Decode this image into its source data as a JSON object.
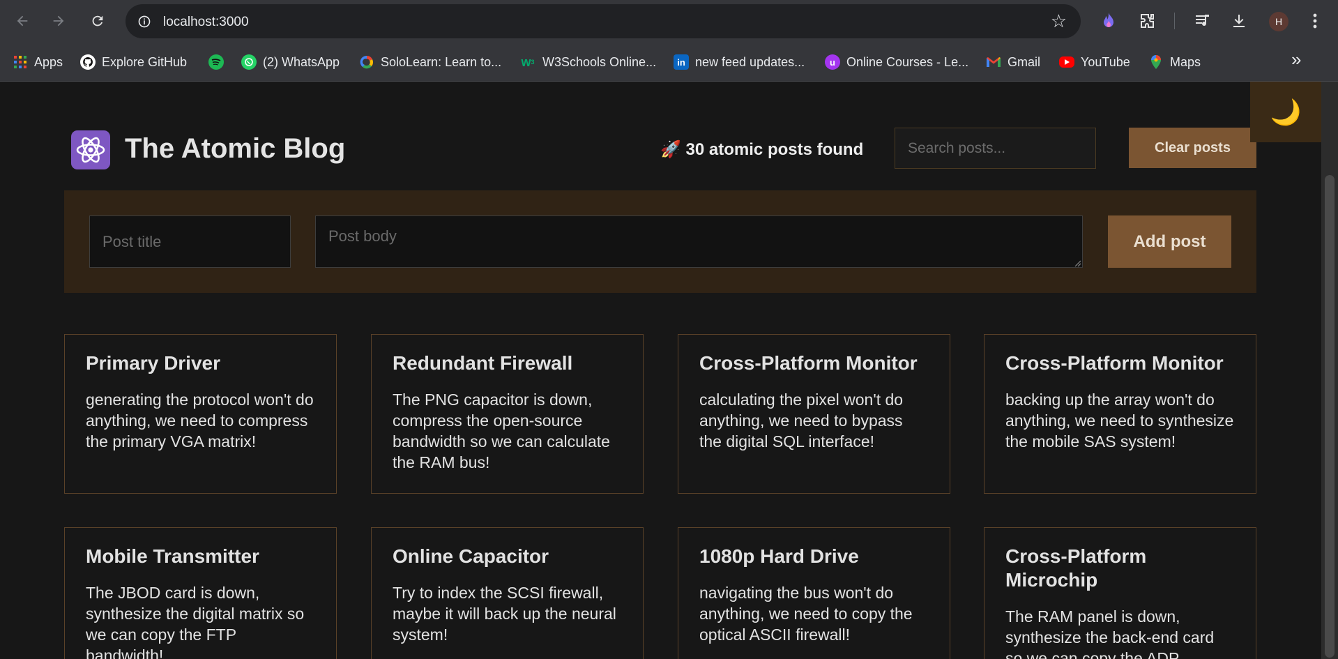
{
  "browser": {
    "url": "localhost:3000",
    "avatar_letter": "H",
    "bookmarks": [
      {
        "label": "Apps",
        "icon": "apps-grid-icon"
      },
      {
        "label": "Explore GitHub",
        "icon": "github-icon"
      },
      {
        "label": "",
        "icon": "spotify-icon"
      },
      {
        "label": "(2) WhatsApp",
        "icon": "whatsapp-icon"
      },
      {
        "label": "SoloLearn: Learn to...",
        "icon": "sololearn-icon"
      },
      {
        "label": "W3Schools Online...",
        "icon": "w3schools-icon"
      },
      {
        "label": "new feed updates...",
        "icon": "linkedin-icon"
      },
      {
        "label": "Online Courses - Le...",
        "icon": "udemy-icon"
      },
      {
        "label": "Gmail",
        "icon": "gmail-icon"
      },
      {
        "label": "YouTube",
        "icon": "youtube-icon"
      },
      {
        "label": "Maps",
        "icon": "maps-icon"
      }
    ]
  },
  "header": {
    "title": "The Atomic Blog",
    "post_count_text": "🚀 30 atomic posts found",
    "search_placeholder": "Search posts...",
    "clear_label": "Clear posts",
    "mode_icon": "🌙"
  },
  "form": {
    "title_placeholder": "Post title",
    "body_placeholder": "Post body",
    "add_label": "Add post"
  },
  "posts": [
    {
      "title": "Primary Driver",
      "body": "generating the protocol won't do anything, we need to compress the primary VGA matrix!"
    },
    {
      "title": "Redundant Firewall",
      "body": "The PNG capacitor is down, compress the open-source bandwidth so we can calculate the RAM bus!"
    },
    {
      "title": "Cross-Platform Monitor",
      "body": "calculating the pixel won't do anything, we need to bypass the digital SQL interface!"
    },
    {
      "title": "Cross-Platform Monitor",
      "body": "backing up the array won't do anything, we need to synthesize the mobile SAS system!"
    },
    {
      "title": "Mobile Transmitter",
      "body": "The JBOD card is down, synthesize the digital matrix so we can copy the FTP bandwidth!"
    },
    {
      "title": "Online Capacitor",
      "body": "Try to index the SCSI firewall, maybe it will back up the neural system!"
    },
    {
      "title": "1080p Hard Drive",
      "body": "navigating the bus won't do anything, we need to copy the optical ASCII firewall!"
    },
    {
      "title": "Cross-Platform Microchip",
      "body": "The RAM panel is down, synthesize the back-end card so we can copy the ADP..."
    }
  ],
  "colors": {
    "accent": "#7b5532",
    "panel": "#302315",
    "card_border": "#5a4128",
    "logo": "#7e57c2"
  }
}
